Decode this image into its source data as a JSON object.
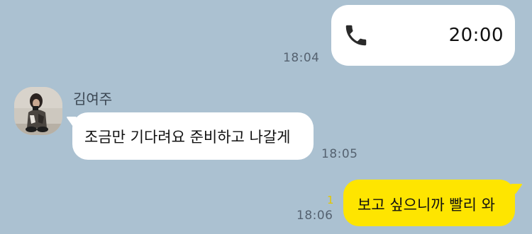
{
  "messages": [
    {
      "type": "call",
      "direction": "outgoing",
      "icon": "phone-icon",
      "duration": "20:00",
      "time": "18:04"
    },
    {
      "type": "text",
      "direction": "incoming",
      "sender": "김여주",
      "avatar": "profile-photo",
      "text": "조금만 기다려요 준비하고 나갈게",
      "time": "18:05"
    },
    {
      "type": "text",
      "direction": "outgoing",
      "text": "보고 싶으니까 빨리 와",
      "unread_count": "1",
      "time": "18:06"
    }
  ],
  "colors": {
    "background": "#abc1d1",
    "incoming_bubble": "#ffffff",
    "outgoing_bubble": "#fee500",
    "unread": "#e3c700",
    "time_text": "#556270"
  }
}
